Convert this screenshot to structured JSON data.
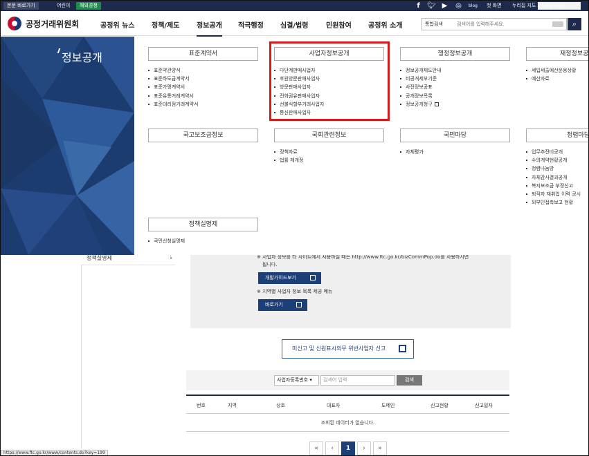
{
  "utility": {
    "skip": "본문 바로가기",
    "kids": "어린이",
    "global": "해외경쟁",
    "first_screen": "첫 화면",
    "sitemap": "누리집 지도",
    "language": "Language"
  },
  "header": {
    "logo_text": "공정거래위원회",
    "nav": [
      "공정위 뉴스",
      "정책/제도",
      "정보공개",
      "적극행정",
      "심결/법령",
      "민원참여",
      "공정위 소개"
    ],
    "search_scope": "통합검색",
    "search_placeholder": "검색어를 입력해주세요."
  },
  "mega": {
    "title": "정보공개",
    "columns": [
      {
        "head": "표준계약서",
        "items": [
          "표준약관양식",
          "표준하도급계약서",
          "표준가맹계약서",
          "표준유통거래계약서",
          "표준대리점거래계약서"
        ]
      },
      {
        "head": "사업자정보공개",
        "items": [
          "다단계판매사업자",
          "후원방문판매사업자",
          "방문판매사업자",
          "전화권유판매사업자",
          "선불식할부거래사업자",
          "통신판매사업자"
        ]
      },
      {
        "head": "행정정보공개",
        "items": [
          "정보공개제도안내",
          "비공개세부기준",
          "사전정보공표",
          "공개정보목록",
          "정보공개청구"
        ]
      },
      {
        "head": "재정정보공개",
        "items": [
          "세입세출예산운용상황",
          "예산자료"
        ]
      },
      {
        "head": "국고보조금정보",
        "items": []
      },
      {
        "head": "국회관련정보",
        "items": [
          "정책자료",
          "법률 제개정"
        ]
      },
      {
        "head": "국민마당",
        "items": [
          "자체평가"
        ]
      },
      {
        "head": "청렴마당",
        "items": [
          "업무추진비공개",
          "수의계약현황공개",
          "청렴나눔방",
          "자체감사결과공개",
          "복지보조금 부정신고",
          "퇴직자 재취업 이력 공시",
          "외부인접촉보고 현황"
        ]
      },
      {
        "head": "정책실명제",
        "items": [
          "국민신청실명제"
        ]
      }
    ]
  },
  "page": {
    "leftnav_item": "정책실명제",
    "notice1": "※ 사업자 정보를 타 사이트에서 사용하실 때는 http://www.ftc.go.kr/bizCommPop.do를 사용하시면",
    "notice1b": "됩니다.",
    "dev_guide_btn": "개발가이드보기",
    "notice2": "※ 지역별 사업자 정보 목록 제공 메뉴",
    "go_btn": "바로가기",
    "report_btn": "미신고 및 신원표시의무 위반사업자 신고",
    "filter_select": "사업자등록번호",
    "filter_placeholder": "검색어 입력",
    "filter_btn": "검색",
    "table_headers": [
      "번호",
      "지역",
      "상호",
      "대표자",
      "도메인",
      "신고현황",
      "신고일자"
    ],
    "empty_msg": "조회된 데이터가 없습니다.",
    "pagination": [
      "«",
      "‹",
      "1",
      "›",
      "»"
    ]
  },
  "status_url": "https://www.ftc.go.kr/www/contents.do?key=199",
  "colors": {
    "navy": "#1d2a4c",
    "highlight": "#d41a1a",
    "button": "#1d3f78"
  }
}
